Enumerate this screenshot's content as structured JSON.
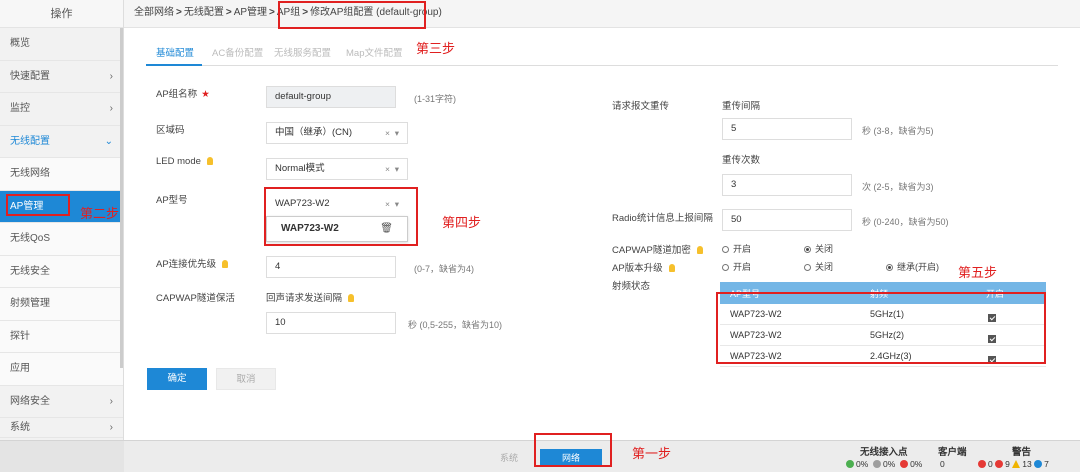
{
  "sidebar": {
    "header": "操作",
    "items": [
      {
        "label": "概览",
        "chevron": ""
      },
      {
        "label": "快速配置",
        "chevron": "›"
      },
      {
        "label": "监控",
        "chevron": "›"
      },
      {
        "label": "无线配置",
        "chevron": "⌄"
      },
      {
        "label": "无线网络",
        "chevron": ""
      },
      {
        "label": "AP管理",
        "chevron": ""
      },
      {
        "label": "无线QoS",
        "chevron": ""
      },
      {
        "label": "无线安全",
        "chevron": ""
      },
      {
        "label": "射频管理",
        "chevron": ""
      },
      {
        "label": "探针",
        "chevron": ""
      },
      {
        "label": "应用",
        "chevron": ""
      },
      {
        "label": "网络安全",
        "chevron": "›"
      },
      {
        "label": "系统",
        "chevron": "›"
      }
    ]
  },
  "breadcrumb": {
    "items": [
      "全部网络",
      "无线配置",
      "AP管理",
      "AP组",
      "修改AP组配置 (default-group)"
    ],
    "separator": ">"
  },
  "tabs": [
    "基础配置",
    "AC备份配置",
    "无线服务配置",
    "Map文件配置"
  ],
  "annotations": {
    "step1": "第一步",
    "step2": "第二步",
    "step3": "第三步",
    "step4": "第四步",
    "step5": "第五步"
  },
  "form": {
    "group_name": {
      "label": "AP组名称",
      "required_mark": "★",
      "value": "default-group",
      "hint": "(1-31字符)"
    },
    "region_code": {
      "label": "区域码",
      "value": "中国（继承）(CN)",
      "clear": "×",
      "caret": "▾"
    },
    "led_mode": {
      "label": "LED mode",
      "value": "Normal模式",
      "clear": "×",
      "caret": "▾"
    },
    "ap_model": {
      "label": "AP型号",
      "value": "WAP723-W2",
      "clear": "×",
      "caret": "▾",
      "dropdown_option": "WAP723-W2",
      "delete_icon": "🗑"
    },
    "priority": {
      "label": "AP连接优先级",
      "value": "4",
      "hint": "(0-7，缺省为4)"
    },
    "capwap_keepalive": {
      "label": "CAPWAP隧道保活",
      "sublabel": "回声请求发送间隔",
      "value": "10",
      "hint": "秒 (0,5-255，缺省为10)"
    }
  },
  "buttons": {
    "confirm": "确定",
    "cancel": "取消"
  },
  "right_form": {
    "retransmit_label": "请求报文重传",
    "interval_label": "重传间隔",
    "interval_value": "5",
    "interval_hint": "秒 (3-8，缺省为5)",
    "count_label": "重传次数",
    "count_value": "3",
    "count_hint": "次 (2-5，缺省为3)",
    "radio_stats_label": "Radio统计信息上报间隔",
    "radio_stats_value": "50",
    "radio_stats_hint": "秒 (0-240，缺省为50)",
    "capwap_encrypt_label": "CAPWAP隧道加密",
    "capwap_encrypt_options": [
      "开启",
      "关闭"
    ],
    "ap_upgrade_label": "AP版本升级",
    "ap_upgrade_options": [
      "开启",
      "关闭",
      "继承(开启)"
    ],
    "radio_state_label": "射频状态"
  },
  "radio_table": {
    "headers": [
      "AP型号",
      "射频",
      "开启"
    ],
    "rows": [
      {
        "model": "WAP723-W2",
        "radio": "5GHz(1)"
      },
      {
        "model": "WAP723-W2",
        "radio": "5GHz(2)"
      },
      {
        "model": "WAP723-W2",
        "radio": "2.4GHz(3)"
      }
    ]
  },
  "footer": {
    "tabs": [
      "系统",
      "网络"
    ],
    "wireless_access_label": "无线接入点",
    "wireless_access_values": [
      "0%",
      "0%",
      "0%"
    ],
    "clients_label": "客户端",
    "clients_value": "0",
    "alerts_label": "警告",
    "alerts_values": [
      "0",
      "9",
      "13",
      "7"
    ]
  },
  "colors": {
    "accent": "#1e88d6",
    "annotation": "#e02020",
    "table_header": "#74b6e6"
  }
}
